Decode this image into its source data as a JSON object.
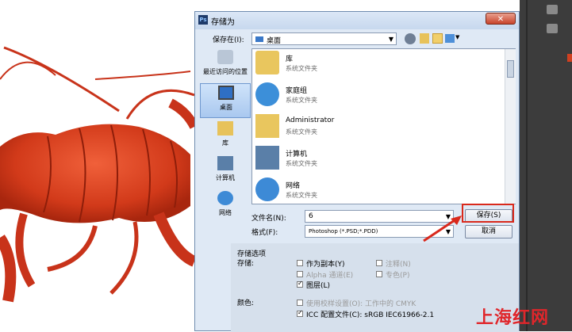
{
  "dialog": {
    "title": "存储为",
    "close_label": "✕",
    "app_logo": "Ps"
  },
  "save_in": {
    "label": "保存在(I):",
    "value": "桌面"
  },
  "places": [
    {
      "label": "最近访问的位置",
      "icon": "recent-places-icon"
    },
    {
      "label": "桌面",
      "icon": "desktop-icon"
    },
    {
      "label": "库",
      "icon": "libraries-icon"
    },
    {
      "label": "计算机",
      "icon": "computer-icon"
    },
    {
      "label": "网络",
      "icon": "network-icon"
    }
  ],
  "files": [
    {
      "name": "库",
      "type": "系统文件夹",
      "icon": "libraries-icon"
    },
    {
      "name": "家庭组",
      "type": "系统文件夹",
      "icon": "homegroup-icon"
    },
    {
      "name": "Administrator",
      "type": "系统文件夹",
      "icon": "user-folder-icon"
    },
    {
      "name": "计算机",
      "type": "系统文件夹",
      "icon": "computer-icon"
    },
    {
      "name": "网络",
      "type": "系统文件夹",
      "icon": "network-icon"
    }
  ],
  "filename": {
    "label": "文件名(N):",
    "value": "6"
  },
  "format": {
    "label": "格式(F):",
    "value": "Photoshop (*.PSD;*.PDD)"
  },
  "buttons": {
    "save": "保存(S)",
    "cancel": "取消"
  },
  "save_options": {
    "section_title": "存储选项",
    "store_label": "存储:",
    "as_copy": "作为副本(Y)",
    "notes": "注释(N)",
    "alpha": "Alpha 通道(E)",
    "spot": "专色(P)",
    "layers": "图层(L)"
  },
  "color": {
    "label": "颜色:",
    "proof": "使用校样设置(O): 工作中的 CMYK",
    "icc": "ICC 配置文件(C): sRGB IEC61966-2.1"
  },
  "watermark": "上海红网",
  "colors": {
    "highlight_box": "#d9291c",
    "arrow": "#d9291c",
    "lobster": "#d8401f"
  }
}
